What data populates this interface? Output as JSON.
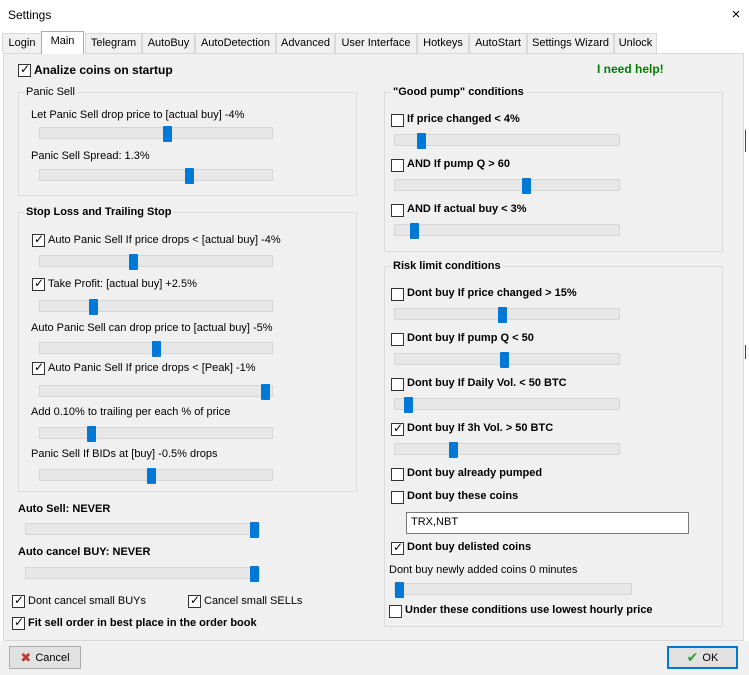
{
  "window": {
    "title": "Settings",
    "close_glyph": "×"
  },
  "tabs": [
    "Login",
    "Main",
    "Telegram",
    "AutoBuy",
    "AutoDetection",
    "Advanced",
    "User Interface",
    "Hotkeys",
    "AutoStart",
    "Settings Wizard",
    "Unlock"
  ],
  "active_tab": "Main",
  "help_link": "I need help!",
  "analyze_on_startup": {
    "label": "Analize coins on startup",
    "checked": true
  },
  "panic_sell": {
    "title": "Panic Sell",
    "drop_label": "Let Panic Sell drop price to [actual buy] -4%",
    "drop_slider": 0.55,
    "spread_label": "Panic Sell Spread: 1.3%",
    "spread_slider": 0.65
  },
  "stop_loss": {
    "title": "Stop Loss and Trailing Stop",
    "auto_panic_label": "Auto Panic Sell If price drops < [actual buy] -4%",
    "auto_panic_checked": true,
    "auto_panic_slider": 0.4,
    "take_profit_label": "Take Profit: [actual buy] +2.5%",
    "take_profit_checked": true,
    "take_profit_slider": 0.22,
    "can_drop_label": "Auto Panic Sell can drop price to [actual buy] -5%",
    "can_drop_slider": 0.5,
    "peak_label": "Auto Panic Sell If price drops < [Peak] -1%",
    "peak_checked": true,
    "peak_slider": 0.99,
    "trailing_label": "Add 0.10% to trailing per each % of price",
    "trailing_slider": 0.21,
    "bids_label": "Panic Sell If BIDs  at [buy] -0.5% drops",
    "bids_slider": 0.48
  },
  "auto_sell": {
    "label": "Auto Sell: NEVER",
    "slider": 1.0
  },
  "auto_cancel": {
    "label": "Auto cancel BUY: NEVER",
    "slider": 1.0
  },
  "dont_cancel_small_buys": {
    "label": "Dont cancel small BUYs",
    "checked": true
  },
  "cancel_small_sells": {
    "label": "Cancel small SELLs",
    "checked": true
  },
  "fit_sell_order": {
    "label": "Fit sell order in best place in the order book",
    "checked": true
  },
  "good_pump": {
    "title": "\"Good pump\" conditions",
    "price_changed_label": "If price changed < 4%",
    "price_changed_checked": false,
    "price_changed_slider": 0.1,
    "pump_q_label": "AND If pump Q > 60",
    "pump_q_checked": false,
    "pump_q_slider": 0.59,
    "actual_buy_label": "AND If actual buy < 3%",
    "actual_buy_checked": false,
    "actual_buy_slider": 0.07
  },
  "risk_limit": {
    "title": "Risk limit conditions",
    "price_changed_label": "Dont buy If price changed > 15%",
    "price_changed_checked": false,
    "price_changed_slider": 0.48,
    "pump_q_label": "Dont buy If pump Q < 50",
    "pump_q_checked": false,
    "pump_q_slider": 0.49,
    "daily_vol_label": "Dont buy If Daily Vol. < 50 BTC",
    "daily_vol_checked": false,
    "daily_vol_slider": 0.04,
    "h3_vol_label": "Dont buy If 3h Vol. > 50 BTC",
    "h3_vol_checked": true,
    "h3_vol_slider": 0.25,
    "already_pumped_label": "Dont buy already pumped",
    "already_pumped_checked": false,
    "these_coins_label": "Dont buy these coins",
    "these_coins_checked": false,
    "these_coins_value": "TRX,NBT",
    "delisted_label": "Dont buy delisted coins",
    "delisted_checked": true,
    "new_coins_label": "Dont buy newly added coins 0 minutes",
    "new_coins_slider": 0.0,
    "lowest_hourly_label": "Under these conditions use lowest hourly price",
    "lowest_hourly_checked": false
  },
  "buttons": {
    "cancel": "Cancel",
    "ok": "OK",
    "cancel_icon": "✖",
    "ok_icon": "✔"
  },
  "colors": {
    "accent": "#0078d7",
    "help": "#008000",
    "cancel_icon": "#c0392b",
    "ok_icon": "#2e9e2e"
  }
}
